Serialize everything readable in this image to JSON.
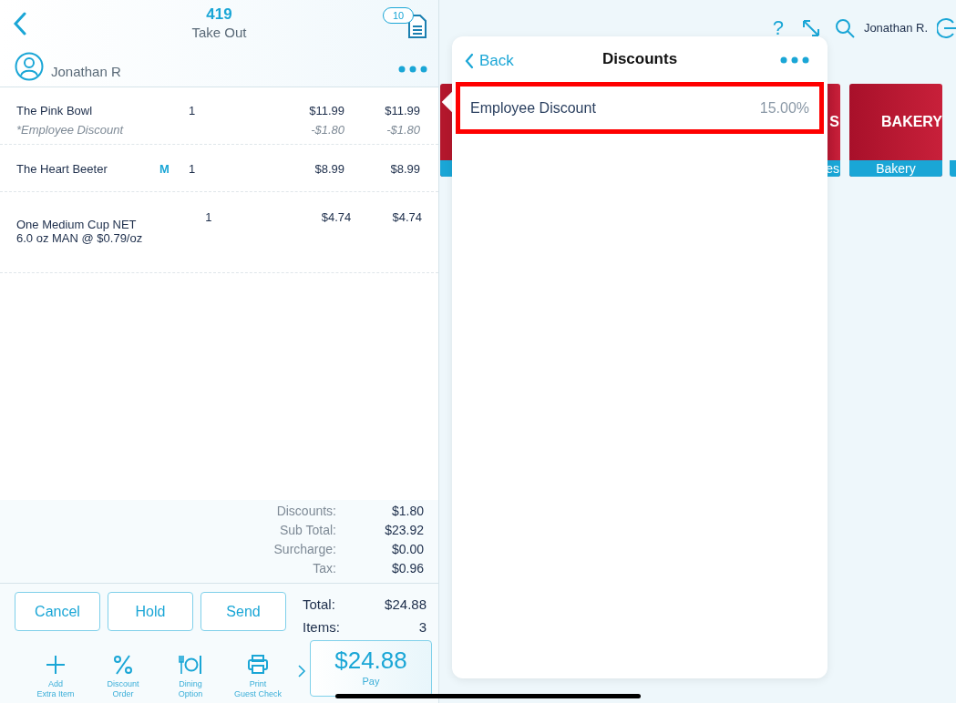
{
  "order": {
    "number": "419",
    "type": "Take Out",
    "badge": "10",
    "customer": "Jonathan R"
  },
  "items": [
    {
      "name": "The Pink Bowl",
      "marker": "",
      "qty": "1",
      "price": "$11.99",
      "total": "$11.99",
      "discount": {
        "label": "*Employee Discount",
        "price": "-$1.80",
        "total": "-$1.80"
      }
    },
    {
      "name": "The Heart Beeter",
      "marker": "M",
      "qty": "1",
      "price": "$8.99",
      "total": "$8.99"
    },
    {
      "name": "One Medium Cup NET 6.0 oz MAN @ $0.79/oz",
      "marker": "",
      "qty": "1",
      "price": "$4.74",
      "total": "$4.74"
    }
  ],
  "totals": [
    {
      "label": "Discounts:",
      "value": "$1.80"
    },
    {
      "label": "Sub Total:",
      "value": "$23.92"
    },
    {
      "label": "Surcharge:",
      "value": "$0.00"
    },
    {
      "label": "Tax:",
      "value": "$0.96"
    }
  ],
  "buttons": [
    "Cancel",
    "Hold",
    "Send"
  ],
  "summary": [
    {
      "label": "Total:",
      "value": "$24.88"
    },
    {
      "label": "Items:",
      "value": "3"
    }
  ],
  "actions": [
    {
      "kind": "add",
      "lines": [
        "Add",
        "Extra Item"
      ]
    },
    {
      "kind": "discount",
      "lines": [
        "Discount",
        "Order"
      ]
    },
    {
      "kind": "dining",
      "lines": [
        "Dining",
        "Option"
      ]
    },
    {
      "kind": "print",
      "lines": [
        "Print",
        "Guest Check"
      ]
    }
  ],
  "pay": {
    "amount": "$24.88",
    "label": "Pay"
  },
  "top_bar": {
    "help": "?",
    "user": "Jonathan R."
  },
  "tiles": [
    {
      "label": "S",
      "caption": "es"
    },
    {
      "label": "BAKERY",
      "caption": "Bakery"
    }
  ],
  "popover": {
    "back": "Back",
    "title": "Discounts",
    "items": [
      {
        "name": "Employee Discount",
        "value": "15.00%",
        "highlighted": true
      }
    ]
  }
}
